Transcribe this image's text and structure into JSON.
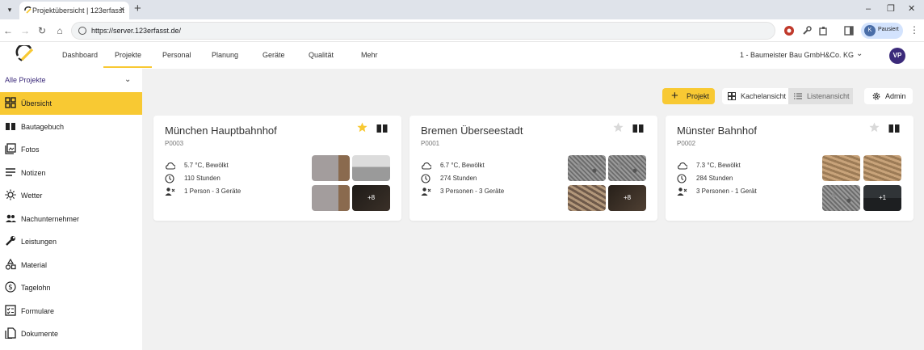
{
  "browser": {
    "tab_title": "Projektübersicht | 123erfasst",
    "url": "https://server.123erfasst.de/",
    "profile_initial": "K",
    "profile_label": "Pausiert"
  },
  "nav": {
    "items": [
      "Dashboard",
      "Projekte",
      "Personal",
      "Planung",
      "Geräte",
      "Qualität",
      "Mehr"
    ],
    "active": "Projekte",
    "company": "1 - Baumeister Bau GmbH&Co. KG",
    "user_initials": "VP"
  },
  "sidebar": {
    "project_filter": "Alle Projekte",
    "items": [
      {
        "label": "Übersicht",
        "icon": "dashboard-icon",
        "active": true
      },
      {
        "label": "Bautagebuch",
        "icon": "book-icon"
      },
      {
        "label": "Fotos",
        "icon": "photos-icon"
      },
      {
        "label": "Notizen",
        "icon": "notes-icon"
      },
      {
        "label": "Wetter",
        "icon": "sun-icon"
      },
      {
        "label": "Nachunternehmer",
        "icon": "people-icon"
      },
      {
        "label": "Leistungen",
        "icon": "wrench-icon"
      },
      {
        "label": "Material",
        "icon": "shapes-icon"
      },
      {
        "label": "Tagelohn",
        "icon": "dollar-icon"
      },
      {
        "label": "Formulare",
        "icon": "form-icon"
      },
      {
        "label": "Dokumente",
        "icon": "documents-icon"
      }
    ]
  },
  "toolbar": {
    "add_project": "Projekt",
    "tile_view": "Kachelansicht",
    "list_view": "Listenansicht",
    "admin": "Admin"
  },
  "projects": [
    {
      "name": "München Hauptbahnhof",
      "code": "P0003",
      "favorite": true,
      "weather": "5.7 °C, Bewölkt",
      "hours": "110 Stunden",
      "resources": "1 Person - 3 Geräte",
      "more_photos": "+8"
    },
    {
      "name": "Bremen Überseestadt",
      "code": "P0001",
      "favorite": false,
      "weather": "6.7 °C, Bewölkt",
      "hours": "274 Stunden",
      "resources": "3 Personen - 3 Geräte",
      "more_photos": "+8"
    },
    {
      "name": "Münster Bahnhof",
      "code": "P0002",
      "favorite": false,
      "weather": "7.3 °C, Bewölkt",
      "hours": "284 Stunden",
      "resources": "3 Personen - 1 Gerät",
      "more_photos": "+1"
    }
  ],
  "colors": {
    "accent": "#f8c933",
    "brand": "#3b2a7a",
    "background": "#f1f1f1"
  }
}
